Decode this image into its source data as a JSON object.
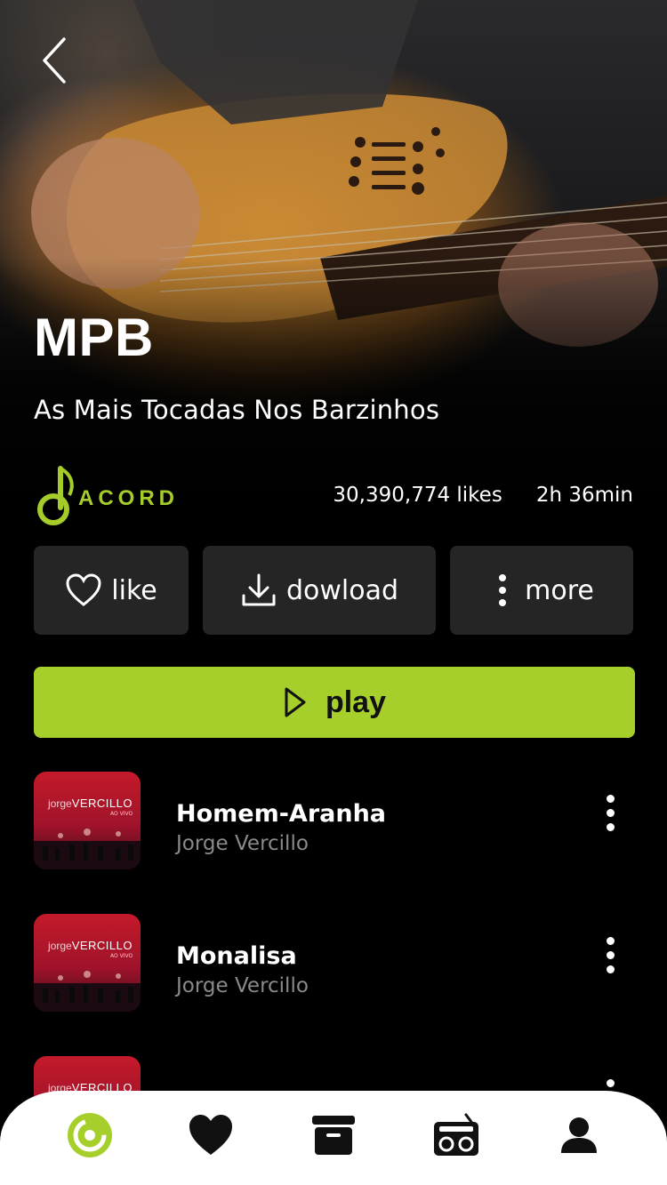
{
  "header": {
    "back_icon": "chevron-left-icon"
  },
  "playlist": {
    "title": "MPB",
    "subtitle": "As Mais Tocadas Nos Barzinhos",
    "brand_name": "ACORD",
    "likes": "30,390,774 likes",
    "duration": "2h 36min"
  },
  "actions": {
    "like_label": "like",
    "download_label": "dowload",
    "more_label": "more",
    "play_label": "play"
  },
  "tracks": [
    {
      "title": "Homem-Aranha",
      "artist": "Jorge Vercillo",
      "cover_text": "jorge",
      "cover_text_bold": "VERCILLO",
      "cover_sub": "AO VIVO"
    },
    {
      "title": "Monalisa",
      "artist": "Jorge Vercillo",
      "cover_text": "jorge",
      "cover_text_bold": "VERCILLO",
      "cover_sub": "AO VIVO"
    },
    {
      "title": "",
      "artist": "",
      "cover_text": "jorge",
      "cover_text_bold": "VERCILLO",
      "cover_sub": ""
    }
  ],
  "tabbar": {
    "items": [
      {
        "icon": "disc-icon",
        "active": true
      },
      {
        "icon": "heart-icon",
        "active": false
      },
      {
        "icon": "archive-icon",
        "active": false
      },
      {
        "icon": "radio-icon",
        "active": false
      },
      {
        "icon": "user-icon",
        "active": false
      }
    ]
  },
  "colors": {
    "accent": "#a6cf2b",
    "button_bg": "#252526",
    "muted_text": "#8a8a8a",
    "background": "#000000"
  }
}
